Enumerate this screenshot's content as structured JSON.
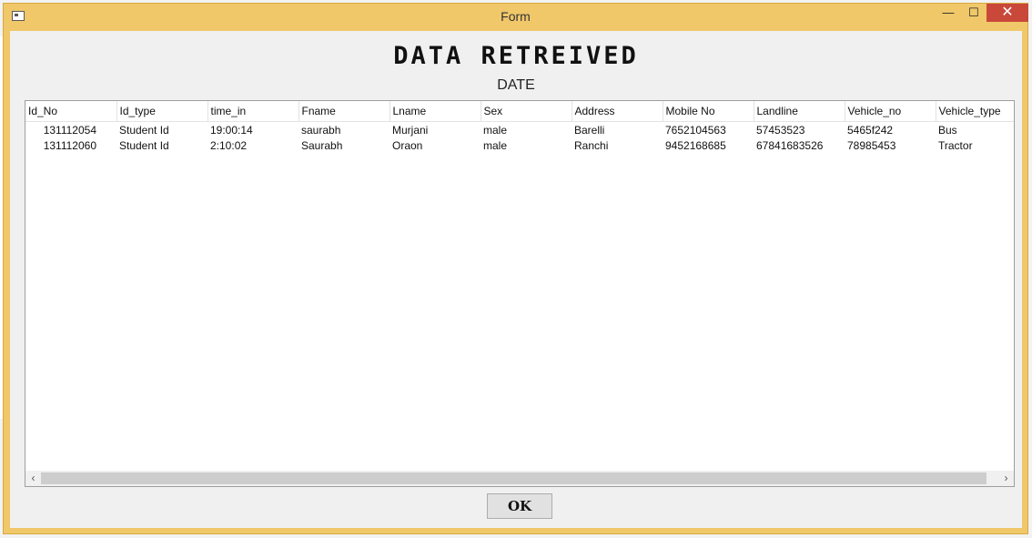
{
  "window": {
    "title": "Form",
    "minimize_glyph": "—",
    "maximize_glyph": "☐",
    "close_glyph": "✕",
    "close_color": "#c9483a",
    "frame_color": "#f0c86a"
  },
  "header": {
    "heading": "DATA RETREIVED",
    "date_label": "DATE"
  },
  "table": {
    "columns": [
      "Id_No",
      "Id_type",
      "time_in",
      "Fname",
      "Lname",
      "Sex",
      "Address",
      "Mobile No",
      "Landline",
      "Vehicle_no",
      "Vehicle_type"
    ],
    "rows": [
      [
        "131112054",
        "Student Id",
        "19:00:14",
        "saurabh",
        "Murjani",
        "male",
        "Barelli",
        "7652104563",
        "57453523",
        "5465f242",
        "Bus"
      ],
      [
        "131112060",
        "Student Id",
        "2:10:02",
        "Saurabh",
        "Oraon",
        "male",
        "Ranchi",
        "9452168685",
        "67841683526",
        "78985453",
        "Tractor"
      ]
    ]
  },
  "scrollbar": {
    "left_arrow": "‹",
    "right_arrow": "›"
  },
  "footer": {
    "ok_label": "OK"
  }
}
